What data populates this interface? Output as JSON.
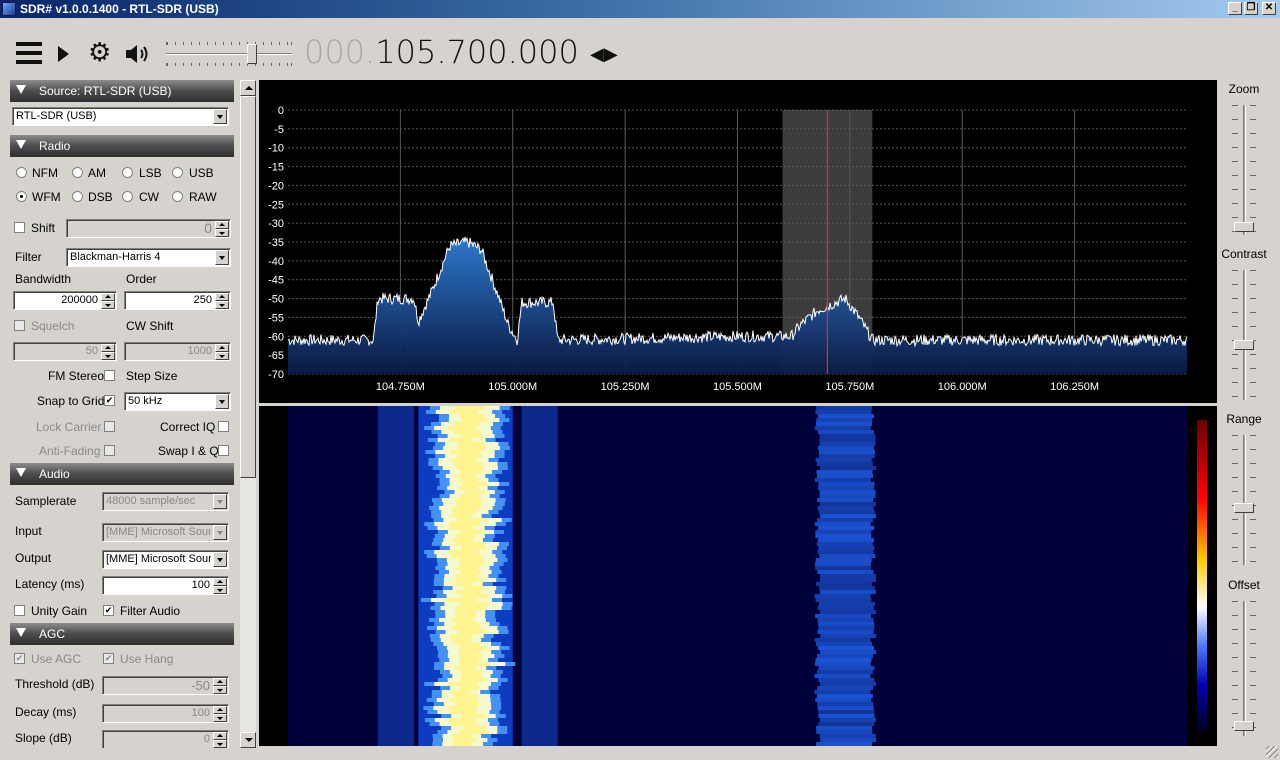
{
  "window": {
    "title": "SDR# v1.0.0.1400 - RTL-SDR (USB)",
    "min_glyph": "_",
    "max_glyph": "❐",
    "close_glyph": "✕"
  },
  "toolbar": {
    "freq_prefix": "000.",
    "freq_main": "105.700.000",
    "freq_arrows": "◀▶",
    "volume_level": 0.7
  },
  "source": {
    "header": "Source: RTL-SDR (USB)",
    "device": "RTL-SDR (USB)"
  },
  "radio": {
    "header": "Radio",
    "modes": [
      "NFM",
      "AM",
      "LSB",
      "USB",
      "WFM",
      "DSB",
      "CW",
      "RAW"
    ],
    "selected_mode": "WFM",
    "shift_label": "Shift",
    "shift_value": "0",
    "filter_label": "Filter",
    "filter_value": "Blackman-Harris 4",
    "bandwidth_label": "Bandwidth",
    "bandwidth_value": "200000",
    "order_label": "Order",
    "order_value": "250",
    "squelch_label": "Squelch",
    "squelch_value": "50",
    "cwshift_label": "CW Shift",
    "cwshift_value": "1000",
    "fmstereo_label": "FM Stereo",
    "stepsize_label": "Step Size",
    "snap_label": "Snap to Grid",
    "snap_value": "50 kHz",
    "lockcarrier_label": "Lock Carrier",
    "correctiq_label": "Correct IQ",
    "antifading_label": "Anti-Fading",
    "swapiq_label": "Swap I & Q"
  },
  "audio": {
    "header": "Audio",
    "samplerate_label": "Samplerate",
    "samplerate_value": "48000 sample/sec",
    "input_label": "Input",
    "input_value": "[MME] Microsoft Sound Mapper",
    "output_label": "Output",
    "output_value": "[MME] Microsoft Sound Mapper",
    "latency_label": "Latency (ms)",
    "latency_value": "100",
    "unitygain_label": "Unity Gain",
    "filteraudio_label": "Filter Audio"
  },
  "agc": {
    "header": "AGC",
    "useagc_label": "Use AGC",
    "usehang_label": "Use Hang",
    "threshold_label": "Threshold (dB)",
    "threshold_value": "-50",
    "decay_label": "Decay (ms)",
    "decay_value": "100",
    "slope_label": "Slope (dB)",
    "slope_value": "0"
  },
  "right_panel": {
    "zoom_label": "Zoom",
    "contrast_label": "Contrast",
    "range_label": "Range",
    "offset_label": "Offset"
  },
  "colors": {
    "spectrum_fill": "#1f5fa8",
    "spectrum_trace": "#ffffff",
    "tuned_line": "#ff2020",
    "waterfall_bg": "#00003a"
  },
  "chart_data": {
    "type": "area",
    "title": "",
    "xlabel": "",
    "ylabel": "",
    "y_ticks": [
      0,
      -5,
      -10,
      -15,
      -20,
      -25,
      -30,
      -35,
      -40,
      -45,
      -50,
      -55,
      -60,
      -65,
      -70
    ],
    "ylim": [
      -70,
      0
    ],
    "x_tick_labels": [
      "104.750M",
      "105.000M",
      "105.250M",
      "105.500M",
      "105.750M",
      "106.000M",
      "106.250M"
    ],
    "x_ticks_mhz": [
      104.75,
      105.0,
      105.25,
      105.5,
      105.75,
      106.0,
      106.25
    ],
    "xlim_mhz": [
      104.5,
      106.5
    ],
    "tuned_freq_mhz": 105.7,
    "filter_band_mhz": [
      105.6,
      105.8
    ],
    "noise_floor_db": -61,
    "signal_points": [
      [
        104.5,
        -61
      ],
      [
        104.69,
        -61
      ],
      [
        104.7,
        -50
      ],
      [
        104.78,
        -50
      ],
      [
        104.79,
        -56
      ],
      [
        104.82,
        -48
      ],
      [
        104.86,
        -36
      ],
      [
        104.9,
        -35
      ],
      [
        104.93,
        -37
      ],
      [
        104.97,
        -50
      ],
      [
        104.99,
        -57
      ],
      [
        105.01,
        -61
      ],
      [
        105.02,
        -51
      ],
      [
        105.09,
        -51
      ],
      [
        105.1,
        -61
      ],
      [
        105.5,
        -60
      ],
      [
        105.55,
        -60
      ],
      [
        105.62,
        -60
      ],
      [
        105.64,
        -57
      ],
      [
        105.68,
        -53
      ],
      [
        105.74,
        -50
      ],
      [
        105.77,
        -55
      ],
      [
        105.8,
        -61
      ],
      [
        106.5,
        -61
      ]
    ],
    "grid": true
  }
}
